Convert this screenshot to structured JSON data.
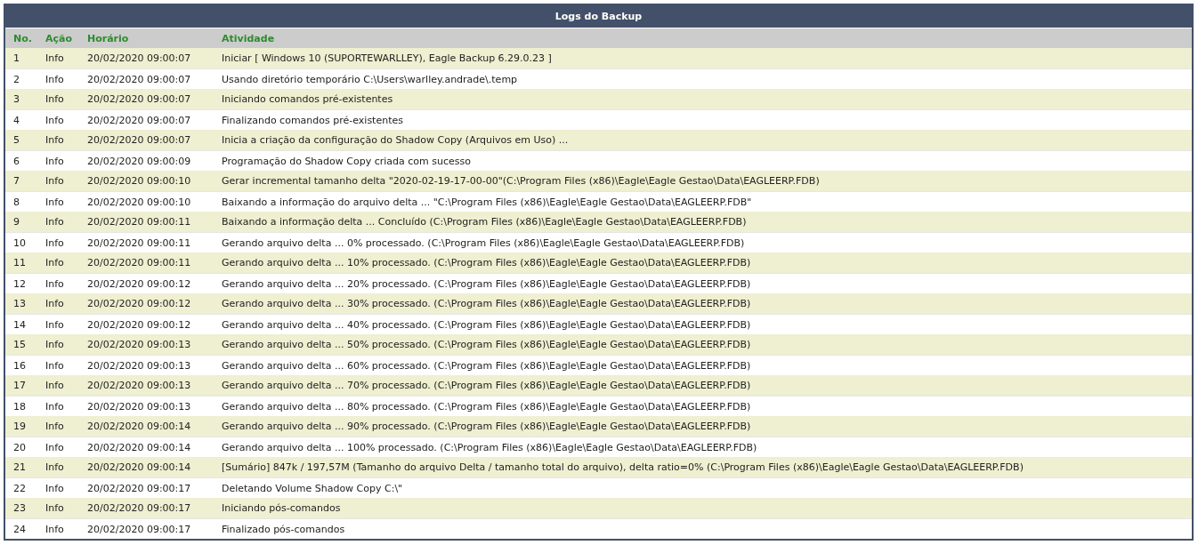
{
  "panel": {
    "title": "Logs do Backup"
  },
  "table": {
    "columns": [
      "No.",
      "Ação",
      "Horário",
      "Atividade"
    ],
    "rows": [
      [
        "1",
        "Info",
        "20/02/2020 09:00:07",
        "Iniciar [ Windows 10 (SUPORTEWARLLEY), Eagle Backup 6.29.0.23 ]"
      ],
      [
        "2",
        "Info",
        "20/02/2020 09:00:07",
        "Usando diretório temporário C:\\Users\\warlley.andrade\\.temp"
      ],
      [
        "3",
        "Info",
        "20/02/2020 09:00:07",
        "Iniciando comandos pré-existentes"
      ],
      [
        "4",
        "Info",
        "20/02/2020 09:00:07",
        "Finalizando comandos pré-existentes"
      ],
      [
        "5",
        "Info",
        "20/02/2020 09:00:07",
        "Inicia a criação da configuração do Shadow Copy (Arquivos em Uso) ..."
      ],
      [
        "6",
        "Info",
        "20/02/2020 09:00:09",
        "Programação do Shadow Copy criada com sucesso"
      ],
      [
        "7",
        "Info",
        "20/02/2020 09:00:10",
        "Gerar incremental tamanho delta \"2020-02-19-17-00-00\"(C:\\Program Files (x86)\\Eagle\\Eagle Gestao\\Data\\EAGLEERP.FDB)"
      ],
      [
        "8",
        "Info",
        "20/02/2020 09:00:10",
        "Baixando a informação do arquivo delta ... \"C:\\Program Files (x86)\\Eagle\\Eagle Gestao\\Data\\EAGLEERP.FDB\""
      ],
      [
        "9",
        "Info",
        "20/02/2020 09:00:11",
        "Baixando a informação delta ... Concluído (C:\\Program Files (x86)\\Eagle\\Eagle Gestao\\Data\\EAGLEERP.FDB)"
      ],
      [
        "10",
        "Info",
        "20/02/2020 09:00:11",
        "Gerando arquivo delta ... 0% processado. (C:\\Program Files (x86)\\Eagle\\Eagle Gestao\\Data\\EAGLEERP.FDB)"
      ],
      [
        "11",
        "Info",
        "20/02/2020 09:00:11",
        "Gerando arquivo delta ... 10% processado. (C:\\Program Files (x86)\\Eagle\\Eagle Gestao\\Data\\EAGLEERP.FDB)"
      ],
      [
        "12",
        "Info",
        "20/02/2020 09:00:12",
        "Gerando arquivo delta ... 20% processado. (C:\\Program Files (x86)\\Eagle\\Eagle Gestao\\Data\\EAGLEERP.FDB)"
      ],
      [
        "13",
        "Info",
        "20/02/2020 09:00:12",
        "Gerando arquivo delta ... 30% processado. (C:\\Program Files (x86)\\Eagle\\Eagle Gestao\\Data\\EAGLEERP.FDB)"
      ],
      [
        "14",
        "Info",
        "20/02/2020 09:00:12",
        "Gerando arquivo delta ... 40% processado. (C:\\Program Files (x86)\\Eagle\\Eagle Gestao\\Data\\EAGLEERP.FDB)"
      ],
      [
        "15",
        "Info",
        "20/02/2020 09:00:13",
        "Gerando arquivo delta ... 50% processado. (C:\\Program Files (x86)\\Eagle\\Eagle Gestao\\Data\\EAGLEERP.FDB)"
      ],
      [
        "16",
        "Info",
        "20/02/2020 09:00:13",
        "Gerando arquivo delta ... 60% processado. (C:\\Program Files (x86)\\Eagle\\Eagle Gestao\\Data\\EAGLEERP.FDB)"
      ],
      [
        "17",
        "Info",
        "20/02/2020 09:00:13",
        "Gerando arquivo delta ... 70% processado. (C:\\Program Files (x86)\\Eagle\\Eagle Gestao\\Data\\EAGLEERP.FDB)"
      ],
      [
        "18",
        "Info",
        "20/02/2020 09:00:13",
        "Gerando arquivo delta ... 80% processado. (C:\\Program Files (x86)\\Eagle\\Eagle Gestao\\Data\\EAGLEERP.FDB)"
      ],
      [
        "19",
        "Info",
        "20/02/2020 09:00:14",
        "Gerando arquivo delta ... 90% processado. (C:\\Program Files (x86)\\Eagle\\Eagle Gestao\\Data\\EAGLEERP.FDB)"
      ],
      [
        "20",
        "Info",
        "20/02/2020 09:00:14",
        "Gerando arquivo delta ... 100% processado. (C:\\Program Files (x86)\\Eagle\\Eagle Gestao\\Data\\EAGLEERP.FDB)"
      ],
      [
        "21",
        "Info",
        "20/02/2020 09:00:14",
        "[Sumário] 847k / 197,57M (Tamanho do arquivo Delta / tamanho total do arquivo), delta ratio=0% (C:\\Program Files (x86)\\Eagle\\Eagle Gestao\\Data\\EAGLEERP.FDB)"
      ],
      [
        "22",
        "Info",
        "20/02/2020 09:00:17",
        "Deletando Volume Shadow Copy C:\\\""
      ],
      [
        "23",
        "Info",
        "20/02/2020 09:00:17",
        "Iniciando pós-comandos"
      ],
      [
        "24",
        "Info",
        "20/02/2020 09:00:17",
        "Finalizado pós-comandos"
      ]
    ]
  }
}
